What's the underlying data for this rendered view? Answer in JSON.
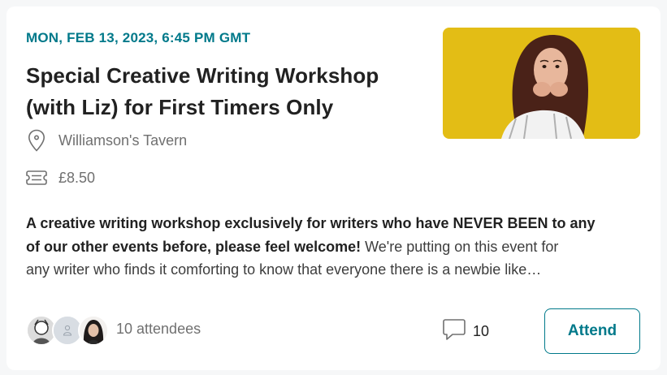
{
  "event": {
    "date": "MON, FEB 13, 2023, 6:45 PM GMT",
    "title_lines": [
      "Special Creative Writing Workshop",
      "(with Liz) for First Timers Only"
    ],
    "venue": "Williamson's Tavern",
    "price": "£8.50",
    "image_icon": "woman-nervous-photo",
    "description": {
      "line1_bold": "A creative writing workshop exclusively for writers who have NEVER BEEN to any",
      "line2_bold": "of our other events before, please feel welcome!",
      "line2_plain": " We're putting on this event for",
      "line3_plain": "any writer who finds it comforting to know that everyone there is a newbie like…"
    }
  },
  "footer": {
    "attendees_label": "10 attendees",
    "comment_icon": "comment-icon",
    "comment_count": "10",
    "attend_label": "Attend"
  },
  "colors": {
    "accent": "#00798a",
    "image_background": "#e8c41a"
  }
}
